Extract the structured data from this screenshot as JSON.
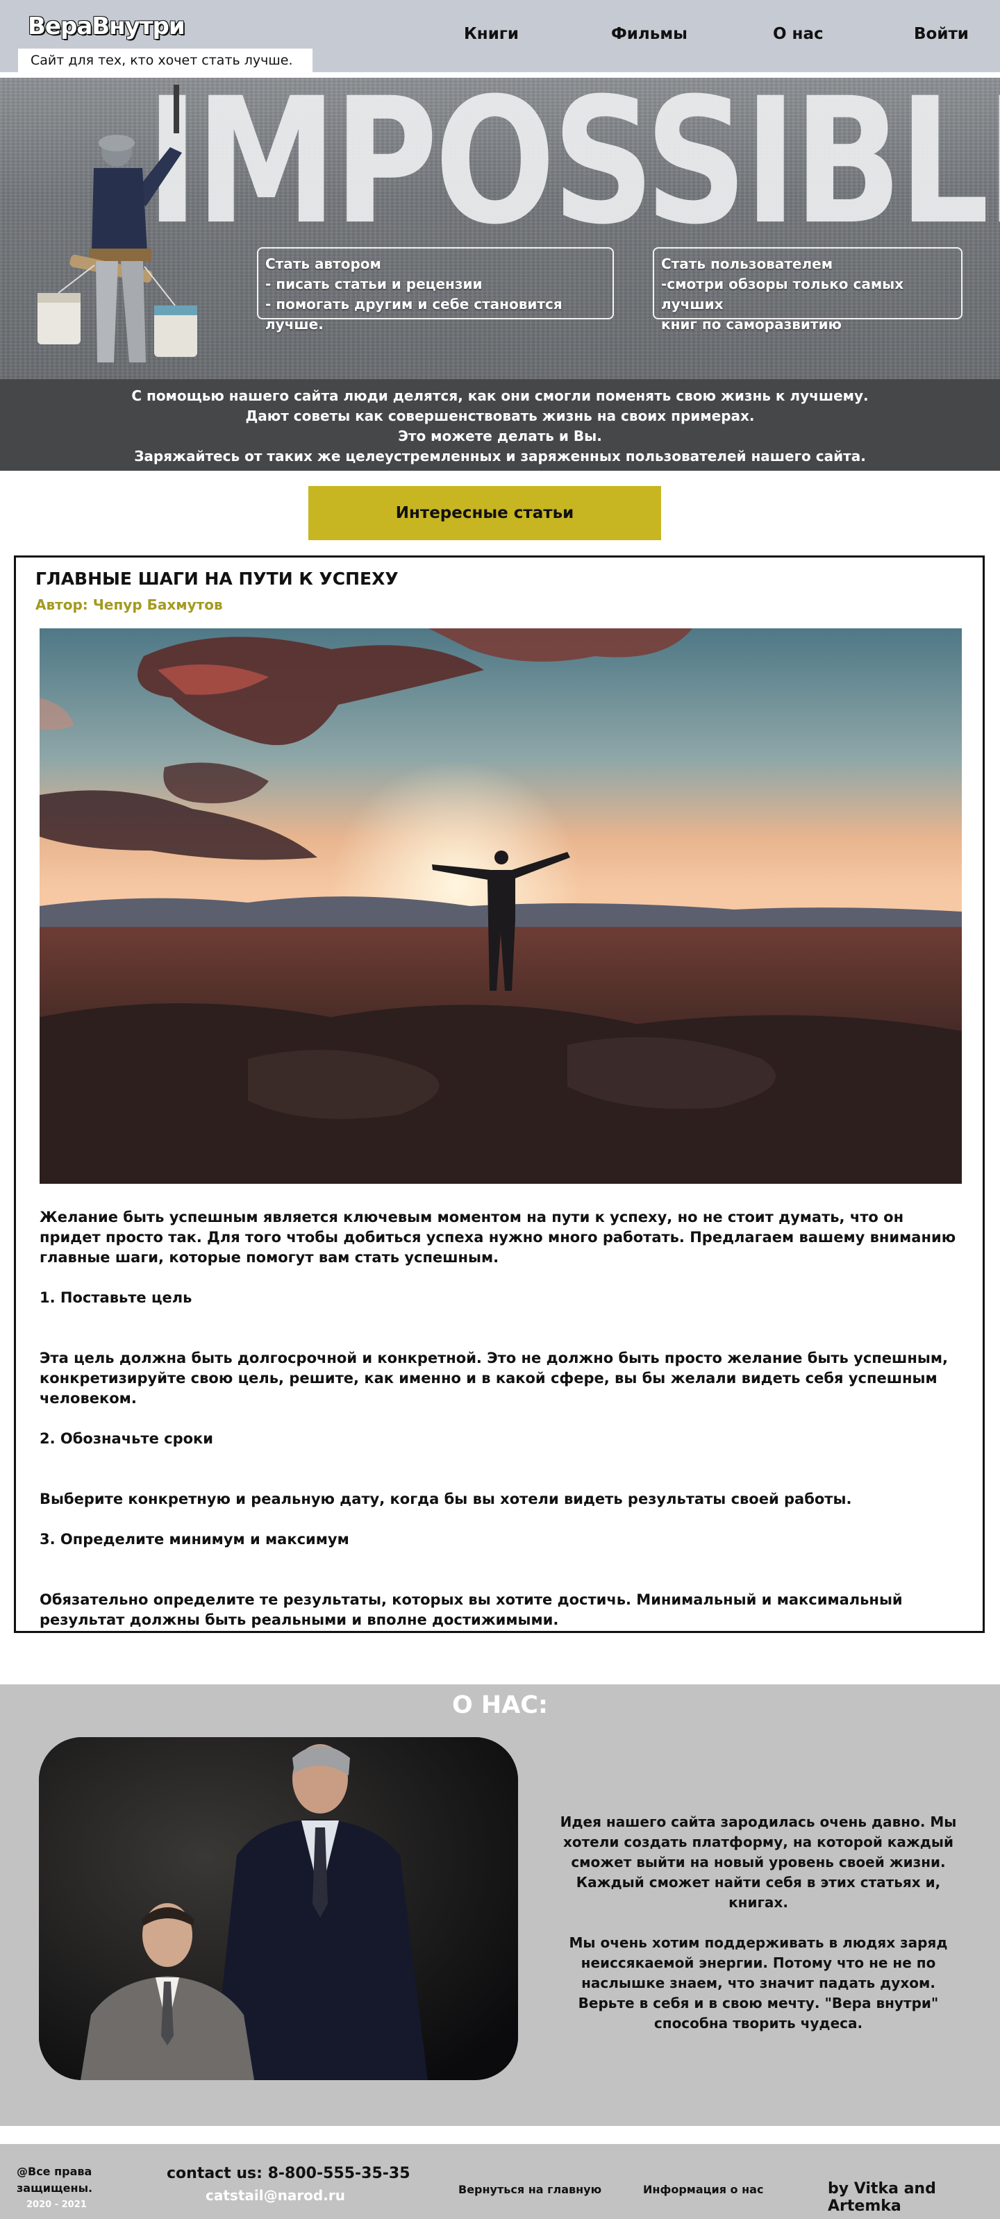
{
  "header": {
    "logo": "ВераВнутри",
    "tagline": "Сайт для тех, кто хочет стать лучше.",
    "nav": [
      "Книги",
      "Фильмы",
      "О нас",
      "Войти"
    ]
  },
  "hero": {
    "background_word": "IMPOSSIBLE",
    "author_card": [
      "Стать автором",
      "- писать статьи и рецензии",
      "- помогать другим и себе становится лучше."
    ],
    "user_card": [
      "Стать пользователем",
      "-смотри обзоры только самых лучших",
      "книг по саморазвитию"
    ],
    "band_lines": [
      "С помощью нашего сайта люди делятся, как они смогли поменять свою жизнь к лучшему.",
      "Дают советы как совершенствовать жизнь на своих примерах.",
      "Это можете делать и Вы.",
      "Заряжайтесь от таких же целеустремленных и заряженных пользователей нашего сайта."
    ],
    "cta_label": "Интересные статьи"
  },
  "article": {
    "title": "ГЛАВНЫЕ ШАГИ НА ПУТИ К УСПЕХУ",
    "author": "Автор: Чепур Бахмутов",
    "intro": "Желание быть успешным является ключевым моментом на пути к успеху, но не стоит думать, что он придет просто так. Для того чтобы добиться успеха нужно много работать. Предлагаем вашему вниманию главные шаги, которые помогут вам стать успешным.",
    "step1_title": "1. Поставьте цель",
    "step1_text": "Эта цель должна быть долгосрочной и конкретной. Это не должно быть просто желание быть успешным, конкретизируйте свою цель, решите, как именно и в какой сфере, вы бы желали видеть себя успешным человеком.",
    "step2_title": "2. Обозначьте сроки",
    "step2_text": "Выберите конкретную и реальную дату, когда бы вы хотели видеть результаты своей работы.",
    "step3_title": "3. Определите минимум и максимум",
    "step3_text": "Обязательно определите те результаты, которых вы хотите достичь. Минимальный и максимальный результат должны быть реальными и вполне достижимыми."
  },
  "about": {
    "title": "О НАС:",
    "paragraph1": "Идея нашего сайта зародилась очень давно. Мы хотели создать платформу, на которой каждый сможет выйти на новый уровень своей жизни. Каждый сможет найти себя в этих статьях и, книгах.",
    "paragraph2": "Мы очень хотим поддерживать в людях заряд неиссякаемой энергии. Потому что не не по наслышке знаем, что значит падать духом. Верьте в себя и в свою мечту. \"Вера внутри\" способна творить чудеса."
  },
  "footer": {
    "rights": "@Все права защищены.",
    "years": "2020 - 2021",
    "contact": "contact us:  8-800-555-35-35",
    "email": "catstail@narod.ru",
    "link_home": "Вернуться на главную",
    "link_about": "Информация о нас",
    "credit": "by Vitka and Artemka"
  }
}
